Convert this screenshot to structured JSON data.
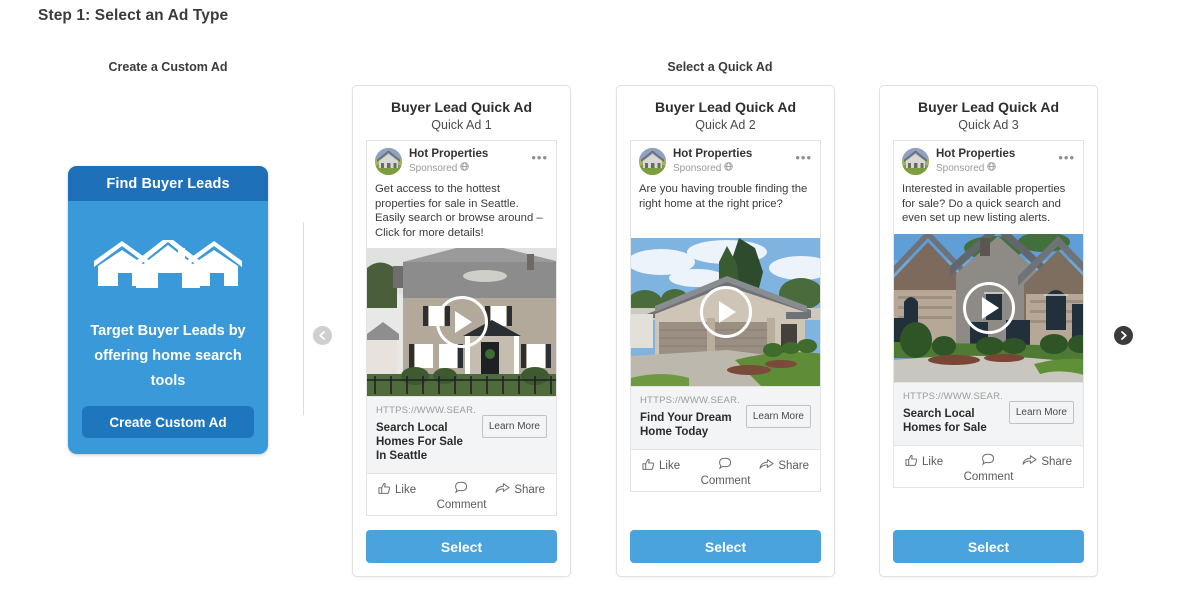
{
  "page": {
    "step_title": "Step 1: Select an Ad Type",
    "custom_heading": "Create a Custom Ad",
    "quick_heading": "Select a Quick Ad"
  },
  "colors": {
    "custom_card_bg": "#3a9ad9",
    "custom_header_bg": "#1e71b8",
    "custom_button_bg": "#1e76bd",
    "select_button_bg": "#4aa3dc",
    "nav_prev_bg": "#cfcfcf",
    "nav_next_bg": "#3b3b3b"
  },
  "custom_ad": {
    "header": "Find Buyer Leads",
    "icon": "houses-icon",
    "body": "Target Buyer Leads by offering home search tools",
    "button_label": "Create Custom Ad"
  },
  "carousel": {
    "prev_label": "prev-arrow-icon",
    "next_label": "next-arrow-icon"
  },
  "quick_ads": [
    {
      "title": "Buyer Lead Quick Ad",
      "subtitle": "Quick Ad 1",
      "page_name": "Hot Properties",
      "sponsored": "Sponsored",
      "body": "Get access to the hottest properties for sale in Seattle. Easily search or browse around – Click for more details!",
      "url": "HTTPS://WWW.SEAR...",
      "headline": "Search Local Homes For Sale In Seattle",
      "cta": "Learn More",
      "like": "Like",
      "comment": "Comment",
      "share": "Share",
      "select": "Select"
    },
    {
      "title": "Buyer Lead Quick Ad",
      "subtitle": "Quick Ad 2",
      "page_name": "Hot Properties",
      "sponsored": "Sponsored",
      "body": "Are you having trouble finding the right home at the right price?",
      "url": "HTTPS://WWW.SEAR...",
      "headline": "Find Your Dream Home Today",
      "cta": "Learn More",
      "like": "Like",
      "comment": "Comment",
      "share": "Share",
      "select": "Select"
    },
    {
      "title": "Buyer Lead Quick Ad",
      "subtitle": "Quick Ad 3",
      "page_name": "Hot Properties",
      "sponsored": "Sponsored",
      "body": "Interested in available properties for sale? Do a quick search and even set up new listing alerts.",
      "url": "HTTPS://WWW.SEAR...",
      "headline": "Search Local Homes for Sale",
      "cta": "Learn More",
      "like": "Like",
      "comment": "Comment",
      "share": "Share",
      "select": "Select"
    }
  ]
}
